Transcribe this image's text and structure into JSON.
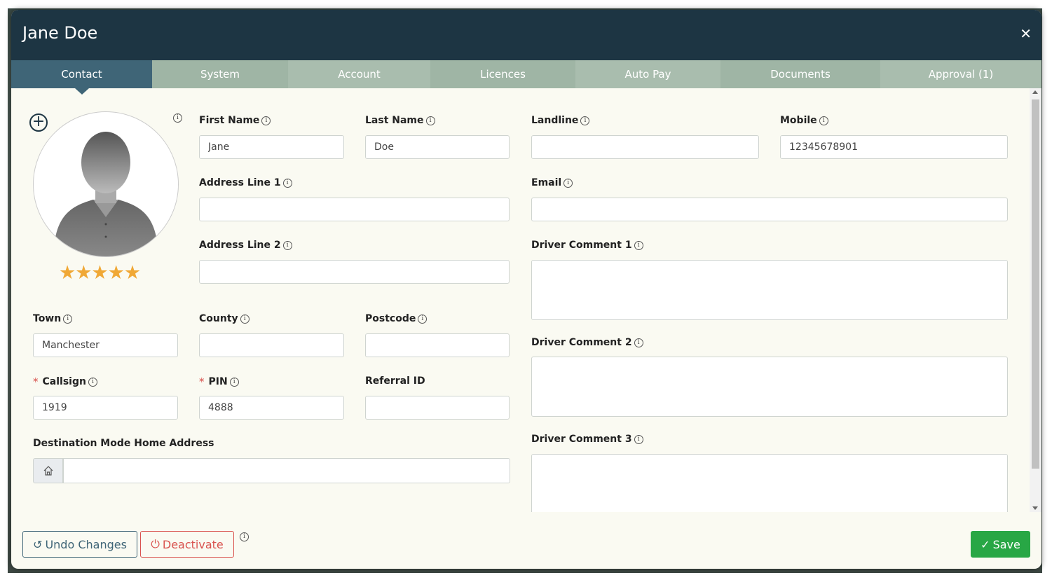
{
  "dialog": {
    "title": "Jane Doe"
  },
  "tabs": [
    {
      "label": "Contact"
    },
    {
      "label": "System"
    },
    {
      "label": "Account"
    },
    {
      "label": "Licences"
    },
    {
      "label": "Auto Pay"
    },
    {
      "label": "Documents"
    },
    {
      "label": "Approval (1)"
    }
  ],
  "profile": {
    "rating": 5,
    "stars": "★★★★★"
  },
  "fields": {
    "first_name": {
      "label": "First Name",
      "value": "Jane"
    },
    "last_name": {
      "label": "Last Name",
      "value": "Doe"
    },
    "landline": {
      "label": "Landline",
      "value": ""
    },
    "mobile": {
      "label": "Mobile",
      "value": "12345678901"
    },
    "address1": {
      "label": "Address Line 1",
      "value": ""
    },
    "email": {
      "label": "Email",
      "value": ""
    },
    "address2": {
      "label": "Address Line 2",
      "value": ""
    },
    "comment1": {
      "label": "Driver Comment 1",
      "value": ""
    },
    "town": {
      "label": "Town",
      "value": "Manchester"
    },
    "county": {
      "label": "County",
      "value": ""
    },
    "postcode": {
      "label": "Postcode",
      "value": ""
    },
    "comment2": {
      "label": "Driver Comment 2",
      "value": ""
    },
    "callsign": {
      "label": "Callsign",
      "value": "1919"
    },
    "pin": {
      "label": "PIN",
      "value": "4888"
    },
    "referral": {
      "label": "Referral ID",
      "value": ""
    },
    "home_address": {
      "label": "Destination Mode Home Address",
      "value": ""
    },
    "comment3": {
      "label": "Driver Comment 3",
      "value": ""
    }
  },
  "required_mark": "*",
  "footer": {
    "undo_label": "Undo Changes",
    "deactivate_label": "Deactivate",
    "save_label": "Save"
  },
  "colors": {
    "header": "#1d3543",
    "active_tab": "#3f6577",
    "tab": "#9fb5a5",
    "save": "#28a745",
    "danger": "#d9534f",
    "star": "#f0a836"
  }
}
